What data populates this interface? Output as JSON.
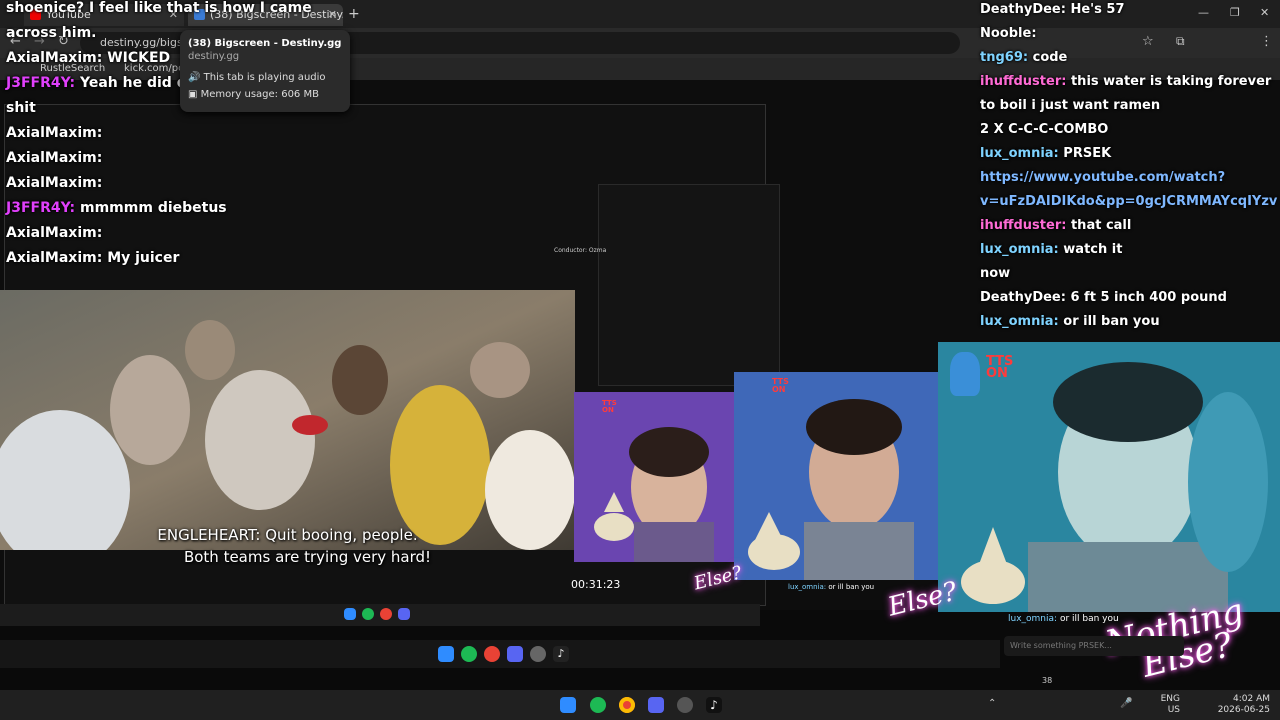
{
  "browser": {
    "tabs": [
      {
        "label": "YouTube"
      },
      {
        "label": "(38) Bigscreen - Destiny.gg"
      }
    ],
    "new_tab_symbol": "+",
    "url": "destiny.gg/bigscreen",
    "bookmarks": [
      "RustleSearch",
      "kick.com/popo"
    ],
    "tooltip": {
      "title": "(38) Bigscreen - Destiny.gg",
      "domain": "destiny.gg",
      "audio": "This tab is playing audio",
      "memory": "Memory usage: 606 MB"
    }
  },
  "left_chat": [
    {
      "name": "",
      "text": "shoenice? I feel like that is how I came",
      "color": "#ffffff"
    },
    {
      "name": "",
      "text": "across him.",
      "color": "#ffffff"
    },
    {
      "name": "AxialMaxim:",
      "text": "WICKED",
      "color": "#ffffff"
    },
    {
      "name": "J3FFR4Y:",
      "text": "Yeah he did do quite weird",
      "color": "#e040fb"
    },
    {
      "name": "",
      "text": "shit",
      "color": "#ffffff"
    },
    {
      "name": "AxialMaxim:",
      "text": "",
      "color": "#ffffff"
    },
    {
      "name": "AxialMaxim:",
      "text": "",
      "color": "#ffffff"
    },
    {
      "name": "AxialMaxim:",
      "text": "",
      "color": "#ffffff"
    },
    {
      "name": "J3FFR4Y:",
      "text": "mmmmm diebetus",
      "color": "#e040fb"
    },
    {
      "name": "AxialMaxim:",
      "text": "",
      "color": "#ffffff"
    },
    {
      "name": "AxialMaxim:",
      "text": "My juicer",
      "color": "#ffffff"
    }
  ],
  "right_chat": [
    {
      "name": "DeathyDee:",
      "text": "He's 57",
      "color": "#ffffff"
    },
    {
      "name": "Nooble:",
      "text": "",
      "color": "#ffffff"
    },
    {
      "name": "tng69:",
      "text": "code",
      "color": "#7fd3ff"
    },
    {
      "name": "ihuffduster:",
      "text": "this water is taking forever",
      "color": "#ff6bd5"
    },
    {
      "name": "",
      "text": "to boil i just want ramen",
      "color": "#ffffff"
    },
    {
      "name": "",
      "text": "2 X C-C-C-COMBO",
      "color": "#ffffff"
    },
    {
      "name": "lux_omnia:",
      "text": "PRSEK",
      "color": "#7fd3ff"
    },
    {
      "name": "",
      "text": "https://www.youtube.com/watch?",
      "color": "#7fb8ff"
    },
    {
      "name": "",
      "text": "v=uFzDAIDIKdo&pp=0gcJCRMMAYcqIYzv",
      "color": "#7fb8ff"
    },
    {
      "name": "ihuffduster:",
      "text": "that call",
      "color": "#ff6bd5"
    },
    {
      "name": "lux_omnia:",
      "text": "watch it",
      "color": "#7fd3ff"
    },
    {
      "name": "",
      "text": "now",
      "color": "#ffffff"
    },
    {
      "name": "DeathyDee:",
      "text": "6 ft 5 inch 400 pound",
      "color": "#ffffff"
    },
    {
      "name": "lux_omnia:",
      "text": "or ill ban you",
      "color": "#7fd3ff"
    }
  ],
  "video": {
    "caption_line1": "ENGLEHEART: Quit booing, people.",
    "caption_line2": "Both teams are trying very hard!",
    "timestamp": "00:31:23",
    "conductor": "Conductor: Ozma"
  },
  "overlay": {
    "tts_line1": "TTS",
    "tts_line2": "ON",
    "neon_line1": "Nothing",
    "neon_line2": "Else?",
    "mini_chat_name": "lux_omnia:",
    "mini_chat_text": "or ill ban you",
    "write_placeholder": "Write something PRSEK...",
    "viewer_count": "38"
  },
  "taskbar": {
    "lang": "ENG",
    "region": "US",
    "time": "4:02 AM",
    "date": "2026-06-25"
  }
}
